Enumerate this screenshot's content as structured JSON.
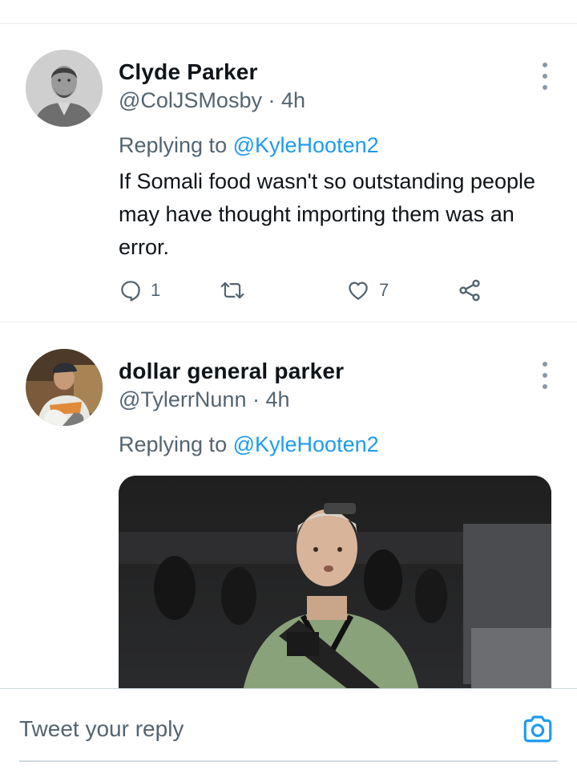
{
  "tweets": [
    {
      "display_name": "Clyde Parker",
      "handle": "@ColJSMosby",
      "separator": "·",
      "time": "4h",
      "replying_prefix": "Replying to",
      "replying_to": "@KyleHooten2",
      "text": "If Somali food wasn't so outstanding people may have thought importing them was an error.",
      "reply_count": "1",
      "retweet_count": "",
      "like_count": "7"
    },
    {
      "display_name": "dollar general parker",
      "handle": "@TylerrNunn",
      "separator": "·",
      "time": "4h",
      "replying_prefix": "Replying to",
      "replying_to": "@KyleHooten2"
    }
  ],
  "composer": {
    "placeholder": "Tweet your reply"
  },
  "colors": {
    "accent": "#1d9bf0",
    "secondary_text": "#536471",
    "primary_text": "#0f1419",
    "divider": "#e6ecf0"
  },
  "icons": {
    "reply": "speech-bubble-icon",
    "retweet": "retweet-icon",
    "like": "heart-icon",
    "share": "share-icon",
    "more": "vertical-dots-icon",
    "camera": "camera-icon"
  }
}
